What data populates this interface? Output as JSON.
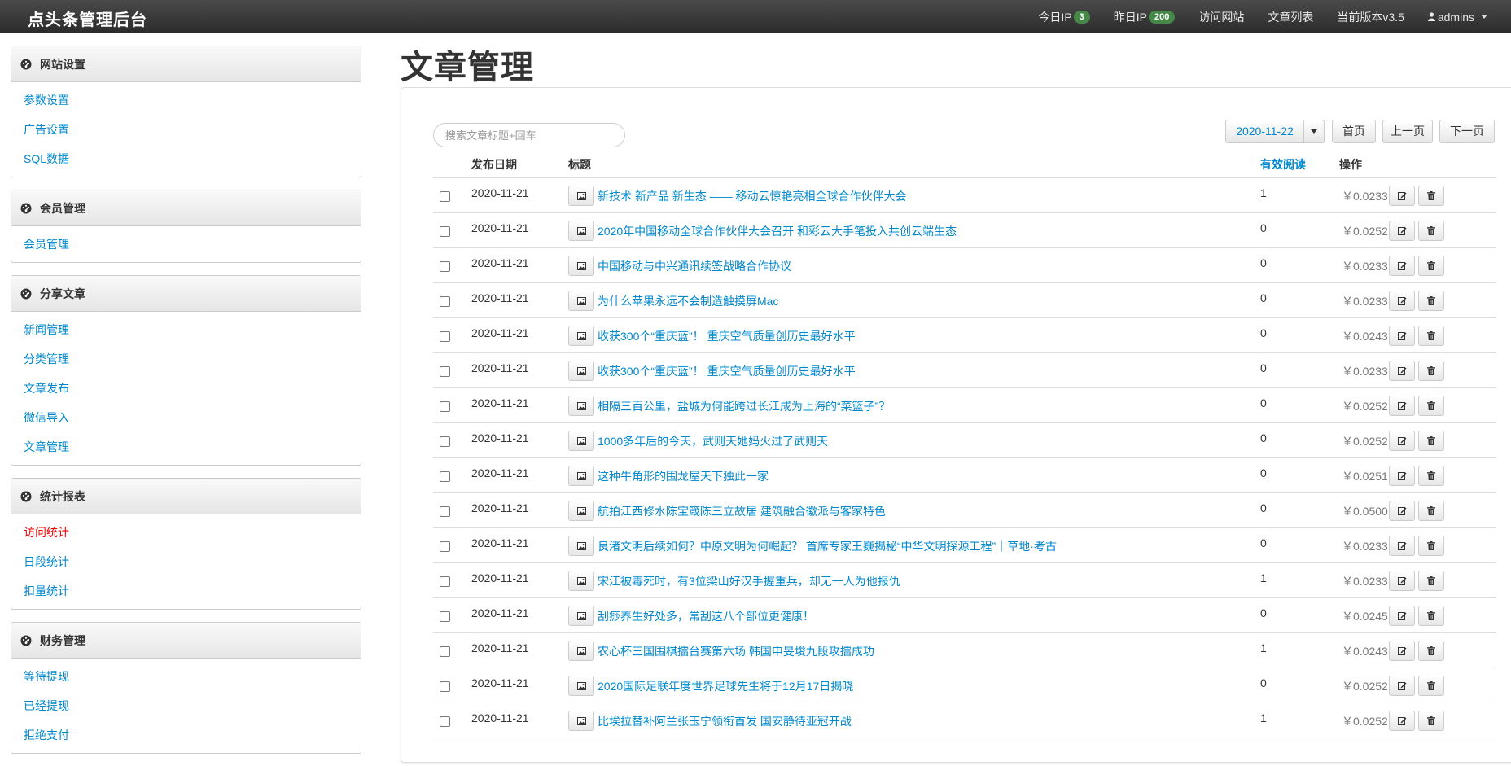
{
  "app": {
    "brand": "点头条管理后台"
  },
  "topnav": {
    "today_ip_label": "今日IP",
    "today_ip_count": "3",
    "yesterday_ip_label": "昨日IP",
    "yesterday_ip_count": "200",
    "visit_site": "访问网站",
    "article_list": "文章列表",
    "version": "当前版本v3.5",
    "user": "admins"
  },
  "sidebar": {
    "panels": [
      {
        "title": "网站设置",
        "items": [
          "参数设置",
          "广告设置",
          "SQL数据"
        ]
      },
      {
        "title": "会员管理",
        "items": [
          "会员管理"
        ]
      },
      {
        "title": "分享文章",
        "items": [
          "新闻管理",
          "分类管理",
          "文章发布",
          "微信导入",
          "文章管理"
        ]
      },
      {
        "title": "统计报表",
        "items": [
          "访问统计",
          "日段统计",
          "扣量统计"
        ]
      },
      {
        "title": "财务管理",
        "items": [
          "等待提现",
          "已经提现",
          "拒绝支付"
        ]
      }
    ]
  },
  "page": {
    "title": "文章管理"
  },
  "toolbar": {
    "search_placeholder": "搜索文章标题+回车",
    "date": "2020-11-22",
    "first_page": "首页",
    "prev_page": "上一页",
    "next_page": "下一页"
  },
  "table": {
    "headers": {
      "date": "发布日期",
      "title": "标题",
      "reads": "有效阅读",
      "action": "操作"
    },
    "rows": [
      {
        "date": "2020-11-21",
        "title": "新技术 新产品 新生态 —— 移动云惊艳亮相全球合作伙伴大会",
        "reads": "1",
        "price": "￥0.0233"
      },
      {
        "date": "2020-11-21",
        "title": "2020年中国移动全球合作伙伴大会召开 和彩云大手笔投入共创云端生态",
        "reads": "0",
        "price": "￥0.0252"
      },
      {
        "date": "2020-11-21",
        "title": "中国移动与中兴通讯续签战略合作协议",
        "reads": "0",
        "price": "￥0.0233"
      },
      {
        "date": "2020-11-21",
        "title": "为什么苹果永远不会制造触摸屏Mac",
        "reads": "0",
        "price": "￥0.0233"
      },
      {
        "date": "2020-11-21",
        "title": "收获300个“重庆蓝”！ 重庆空气质量创历史最好水平",
        "reads": "0",
        "price": "￥0.0243"
      },
      {
        "date": "2020-11-21",
        "title": "收获300个“重庆蓝”！ 重庆空气质量创历史最好水平",
        "reads": "0",
        "price": "￥0.0233"
      },
      {
        "date": "2020-11-21",
        "title": "相隔三百公里，盐城为何能跨过长江成为上海的“菜篮子”？",
        "reads": "0",
        "price": "￥0.0252"
      },
      {
        "date": "2020-11-21",
        "title": "1000多年后的今天，武则天她妈火过了武则天",
        "reads": "0",
        "price": "￥0.0252"
      },
      {
        "date": "2020-11-21",
        "title": "这种牛角形的围龙屋天下独此一家",
        "reads": "0",
        "price": "￥0.0251"
      },
      {
        "date": "2020-11-21",
        "title": "航拍江西修水陈宝箴陈三立故居 建筑融合徽派与客家特色",
        "reads": "0",
        "price": "￥0.0500"
      },
      {
        "date": "2020-11-21",
        "title": "良渚文明后续如何？中原文明为何崛起？ 首席专家王巍揭秘“中华文明探源工程”｜草地·考古",
        "reads": "0",
        "price": "￥0.0233"
      },
      {
        "date": "2020-11-21",
        "title": "宋江被毒死时，有3位梁山好汉手握重兵，却无一人为他报仇",
        "reads": "1",
        "price": "￥0.0233"
      },
      {
        "date": "2020-11-21",
        "title": "刮痧养生好处多，常刮这八个部位更健康！",
        "reads": "0",
        "price": "￥0.0245"
      },
      {
        "date": "2020-11-21",
        "title": "农心杯三国围棋擂台赛第六场 韩国申旻埈九段攻擂成功",
        "reads": "1",
        "price": "￥0.0243"
      },
      {
        "date": "2020-11-21",
        "title": "2020国际足联年度世界足球先生将于12月17日揭晓",
        "reads": "0",
        "price": "￥0.0252"
      },
      {
        "date": "2020-11-21",
        "title": "比埃拉替补阿兰张玉宁领衔首发 国安静待亚冠开战",
        "reads": "1",
        "price": "￥0.0252"
      }
    ]
  }
}
